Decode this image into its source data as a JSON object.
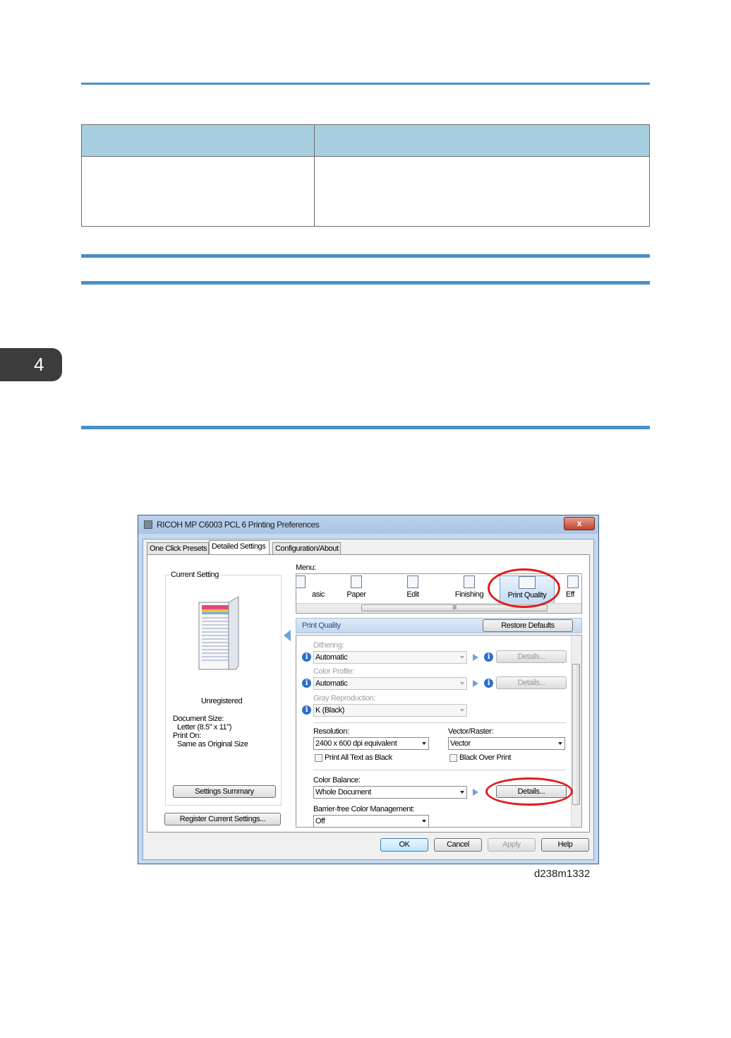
{
  "chapter": {
    "number": "4"
  },
  "window": {
    "title": "RICOH MP C6003 PCL 6 Printing Preferences",
    "close_glyph": "x",
    "tabs": [
      "One Click Presets",
      "Detailed Settings",
      "Configuration/About"
    ],
    "current_setting": {
      "label": "Current Setting",
      "name": "Unregistered",
      "document_size_label": "Document Size:",
      "document_size": "Letter (8.5\" x 11\")",
      "print_on_label": "Print On:",
      "print_on": "Same as Original Size",
      "summary_button": "Settings Summary",
      "register_button": "Register Current Settings..."
    },
    "menu": {
      "label": "Menu:",
      "items": [
        "asic",
        "Paper",
        "Edit",
        "Finishing",
        "Print Quality",
        "Eff"
      ],
      "scroll_mark": "III"
    },
    "section": {
      "title": "Print Quality",
      "restore_button": "Restore Defaults"
    },
    "settings": {
      "dithering_label": "Dithering:",
      "dithering_value": "Automatic",
      "color_profile_label": "Color Profile:",
      "color_profile_value": "Automatic",
      "gray_label": "Gray Reproduction:",
      "gray_value": "K (Black)",
      "resolution_label": "Resolution:",
      "resolution_value": "2400 x 600 dpi equivalent",
      "vector_label": "Vector/Raster:",
      "vector_value": "Vector",
      "print_all_black": "Print All Text as Black",
      "black_over_print": "Black Over Print",
      "color_balance_label": "Color Balance:",
      "color_balance_value": "Whole Document",
      "barrier_free_label": "Barrier-free Color Management:",
      "barrier_free_value": "Off",
      "details_label": "Details...",
      "info_glyph": "i"
    },
    "footer": {
      "ok": "OK",
      "cancel": "Cancel",
      "apply": "Apply",
      "help": "Help"
    }
  },
  "figure_caption": "d238m1332"
}
